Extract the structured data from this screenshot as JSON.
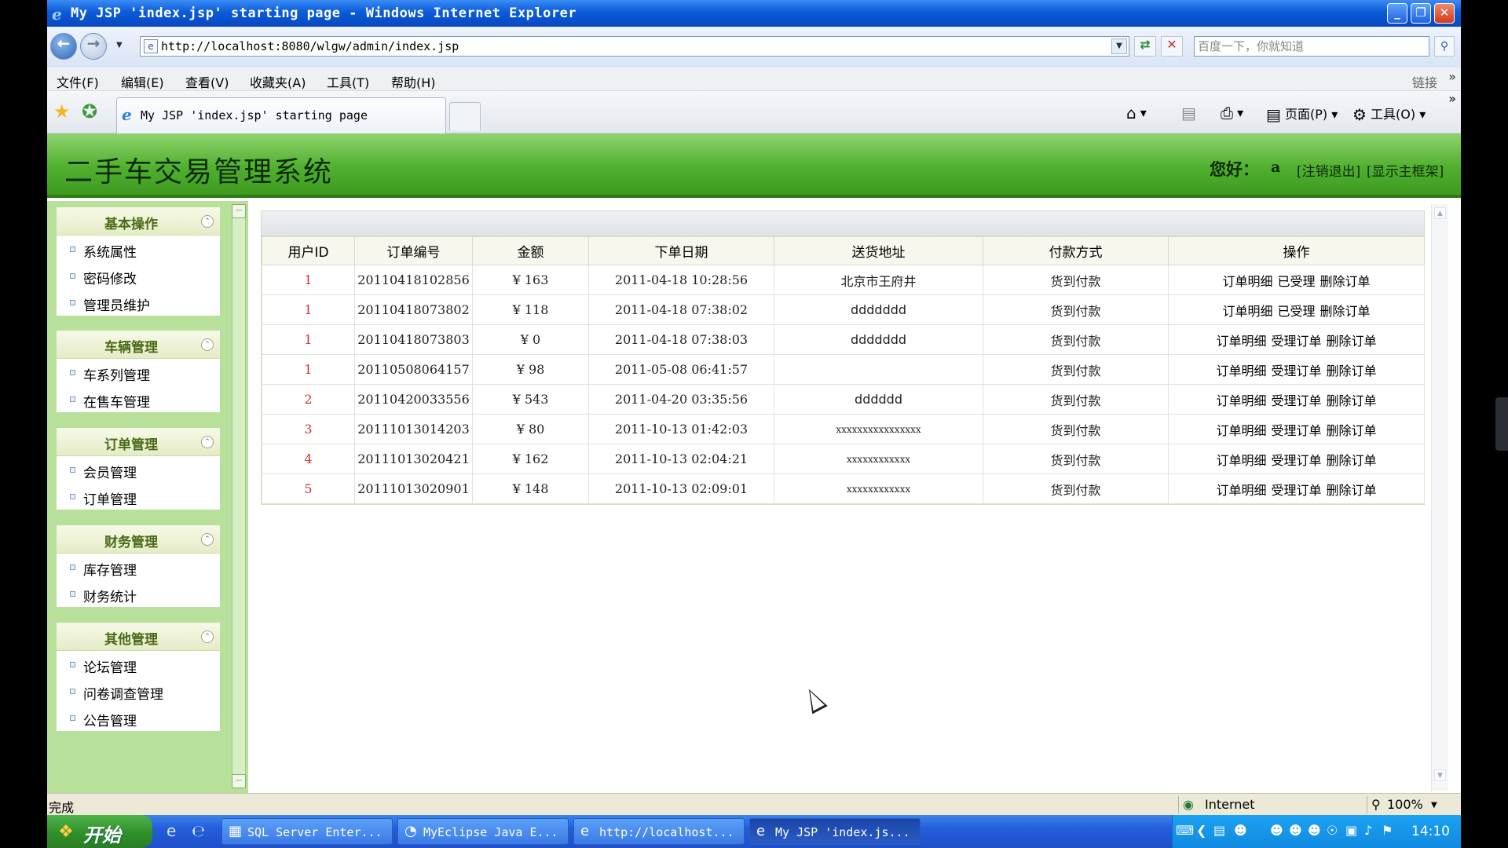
{
  "window": {
    "title": "My JSP 'index.jsp' starting page - Windows Internet Explorer",
    "minimize": "_",
    "maximize": "❐",
    "close": "✕"
  },
  "address_bar": {
    "url": "http://localhost:8080/wlgw/admin/index.jsp",
    "search_placeholder": "百度一下，你就知道"
  },
  "menu": {
    "items": [
      "文件(F)",
      "编辑(E)",
      "查看(V)",
      "收藏夹(A)",
      "工具(T)",
      "帮助(H)"
    ],
    "links": "链接"
  },
  "tabs": {
    "active": "My JSP 'index.jsp' starting page"
  },
  "command_bar": {
    "page": "页面(P)",
    "tools": "工具(O)"
  },
  "header": {
    "system_title": "二手车交易管理系统",
    "greeting": "您好：",
    "username": "a",
    "logout": "[注销退出]",
    "show_frame": "[显示主框架]"
  },
  "sidebar": {
    "groups": [
      {
        "title": "基本操作",
        "items": [
          "系统属性",
          "密码修改",
          "管理员维护"
        ]
      },
      {
        "title": "车辆管理",
        "items": [
          "车系列管理",
          "在售车管理"
        ]
      },
      {
        "title": "订单管理",
        "items": [
          "会员管理",
          "订单管理"
        ]
      },
      {
        "title": "财务管理",
        "items": [
          "库存管理",
          "财务统计"
        ]
      },
      {
        "title": "其他管理",
        "items": [
          "论坛管理",
          "问卷调查管理",
          "公告管理"
        ]
      }
    ]
  },
  "orders": {
    "columns": [
      "用户ID",
      "订单编号",
      "金额",
      "下单日期",
      "送货地址",
      "付款方式",
      "操作"
    ],
    "rows": [
      {
        "uid": "1",
        "order_no": "20110418102856",
        "amount": "¥ 163",
        "date": "2011-04-18 10:28:56",
        "address": "北京市王府井",
        "payment": "货到付款",
        "actions": [
          "订单明细",
          "已受理",
          "删除订单"
        ]
      },
      {
        "uid": "1",
        "order_no": "20110418073802",
        "amount": "¥ 118",
        "date": "2011-04-18 07:38:02",
        "address": "ddddddd",
        "payment": "货到付款",
        "actions": [
          "订单明细",
          "已受理",
          "删除订单"
        ]
      },
      {
        "uid": "1",
        "order_no": "20110418073803",
        "amount": "¥ 0",
        "date": "2011-04-18 07:38:03",
        "address": "ddddddd",
        "payment": "货到付款",
        "actions": [
          "订单明细",
          "受理订单",
          "删除订单"
        ]
      },
      {
        "uid": "1",
        "order_no": "20110508064157",
        "amount": "¥ 98",
        "date": "2011-05-08 06:41:57",
        "address": "",
        "payment": "货到付款",
        "actions": [
          "订单明细",
          "受理订单",
          "删除订单"
        ]
      },
      {
        "uid": "2",
        "order_no": "20110420033556",
        "amount": "¥ 543",
        "date": "2011-04-20 03:35:56",
        "address": "dddddd",
        "payment": "货到付款",
        "actions": [
          "订单明细",
          "受理订单",
          "删除订单"
        ]
      },
      {
        "uid": "3",
        "order_no": "20111013014203",
        "amount": "¥ 80",
        "date": "2011-10-13 01:42:03",
        "address": "xxxxxxxxxxxxxxxx",
        "payment": "货到付款",
        "actions": [
          "订单明细",
          "受理订单",
          "删除订单"
        ]
      },
      {
        "uid": "4",
        "order_no": "20111013020421",
        "amount": "¥ 162",
        "date": "2011-10-13 02:04:21",
        "address": "xxxxxxxxxxxx",
        "payment": "货到付款",
        "actions": [
          "订单明细",
          "受理订单",
          "删除订单"
        ]
      },
      {
        "uid": "5",
        "order_no": "20111013020901",
        "amount": "¥ 148",
        "date": "2011-10-13 02:09:01",
        "address": "xxxxxxxxxxxx",
        "payment": "货到付款",
        "actions": [
          "订单明细",
          "受理订单",
          "删除订单"
        ]
      }
    ]
  },
  "status_bar": {
    "status": "完成",
    "zone": "Internet",
    "zoom": "100%"
  },
  "taskbar": {
    "start": "开始",
    "tasks": [
      "SQL Server Enter...",
      "MyEclipse Java E...",
      "http://localhost...",
      "My JSP 'index.js..."
    ],
    "clock": "14:10"
  },
  "colors": {
    "header_green": "#51b02f",
    "sidebar_green": "#b7e19a",
    "uid_red": "#d03030",
    "xp_blue": "#245ddb"
  }
}
